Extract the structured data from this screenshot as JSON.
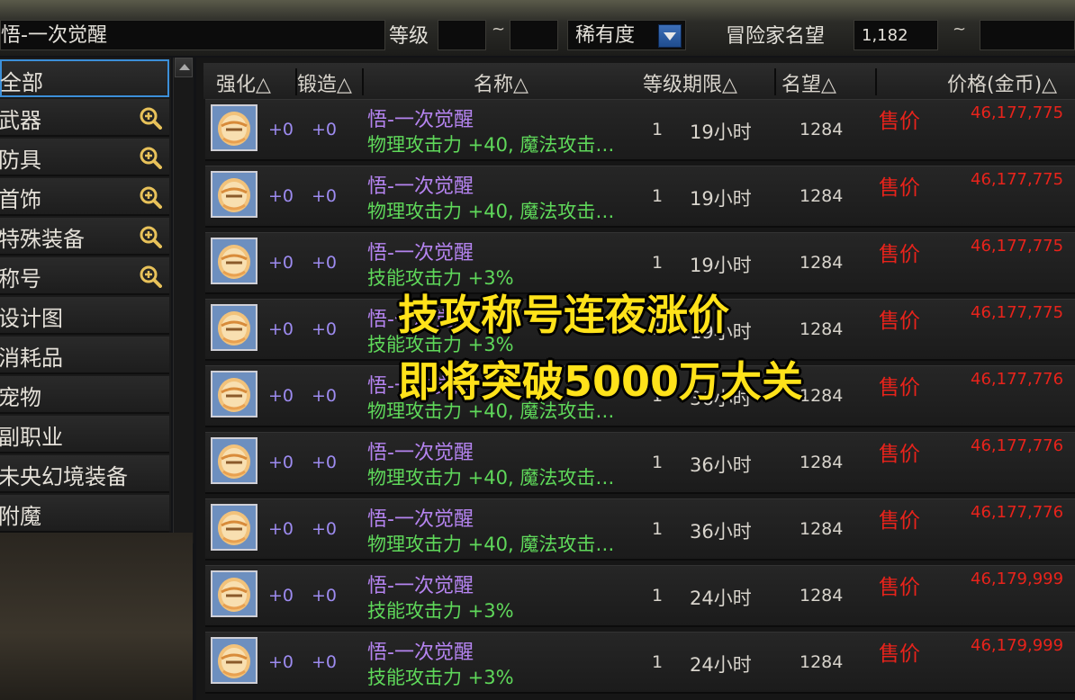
{
  "search": {
    "keyword": "悟-一次觉醒",
    "level_label": "等级",
    "level_min": "",
    "tilde": "~",
    "level_max": "",
    "rarity_label": "稀有度",
    "fame_label": "冒险家名望",
    "fame_min": "1,182",
    "fame_max": ""
  },
  "sidebar": {
    "items": [
      {
        "label": "全部",
        "icon": "none"
      },
      {
        "label": "武器",
        "icon": "zoom-in-icon"
      },
      {
        "label": "防具",
        "icon": "zoom-in-icon"
      },
      {
        "label": "首饰",
        "icon": "zoom-in-icon"
      },
      {
        "label": "特殊装备",
        "icon": "zoom-in-icon"
      },
      {
        "label": "称号",
        "icon": "zoom-in-icon"
      },
      {
        "label": "设计图",
        "icon": "none"
      },
      {
        "label": "消耗品",
        "icon": "none"
      },
      {
        "label": "宠物",
        "icon": "none"
      },
      {
        "label": "副职业",
        "icon": "none"
      },
      {
        "label": "未央幻境装备",
        "icon": "none"
      },
      {
        "label": "附魔",
        "icon": "none"
      }
    ]
  },
  "table": {
    "headers": {
      "enhance": "强化△",
      "forge": "锻造△",
      "name": "名称△",
      "level_expiry": "等级期限△",
      "fame": "名望△",
      "price": "价格(金币)△"
    },
    "rows": [
      {
        "enhance": "+0",
        "forge": "+0",
        "name": "悟-一次觉醒",
        "desc": "物理攻击力 +40, 魔法攻击…",
        "level": "1",
        "expiry": "19小时",
        "fame": "1284",
        "sale": "售价",
        "price": "46,177,775"
      },
      {
        "enhance": "+0",
        "forge": "+0",
        "name": "悟-一次觉醒",
        "desc": "物理攻击力 +40, 魔法攻击…",
        "level": "1",
        "expiry": "19小时",
        "fame": "1284",
        "sale": "售价",
        "price": "46,177,775"
      },
      {
        "enhance": "+0",
        "forge": "+0",
        "name": "悟-一次觉醒",
        "desc": "技能攻击力 +3%",
        "level": "1",
        "expiry": "19小时",
        "fame": "1284",
        "sale": "售价",
        "price": "46,177,775"
      },
      {
        "enhance": "+0",
        "forge": "+0",
        "name": "悟-一次觉醒",
        "desc": "技能攻击力 +3%",
        "level": "1",
        "expiry": "19小时",
        "fame": "1284",
        "sale": "售价",
        "price": "46,177,775"
      },
      {
        "enhance": "+0",
        "forge": "+0",
        "name": "悟-一次觉醒",
        "desc": "物理攻击力 +40, 魔法攻击…",
        "level": "1",
        "expiry": "36小时",
        "fame": "1284",
        "sale": "售价",
        "price": "46,177,776"
      },
      {
        "enhance": "+0",
        "forge": "+0",
        "name": "悟-一次觉醒",
        "desc": "物理攻击力 +40, 魔法攻击…",
        "level": "1",
        "expiry": "36小时",
        "fame": "1284",
        "sale": "售价",
        "price": "46,177,776"
      },
      {
        "enhance": "+0",
        "forge": "+0",
        "name": "悟-一次觉醒",
        "desc": "物理攻击力 +40, 魔法攻击…",
        "level": "1",
        "expiry": "36小时",
        "fame": "1284",
        "sale": "售价",
        "price": "46,177,776"
      },
      {
        "enhance": "+0",
        "forge": "+0",
        "name": "悟-一次觉醒",
        "desc": "技能攻击力 +3%",
        "level": "1",
        "expiry": "24小时",
        "fame": "1284",
        "sale": "售价",
        "price": "46,179,999"
      },
      {
        "enhance": "+0",
        "forge": "+0",
        "name": "悟-一次觉醒",
        "desc": "技能攻击力 +3%",
        "level": "1",
        "expiry": "24小时",
        "fame": "1284",
        "sale": "售价",
        "price": "46,179,999"
      }
    ]
  },
  "overlay": {
    "line1": "技攻称号连夜涨价",
    "line2": "即将突破5000万大关"
  },
  "colors": {
    "item_name": "#b584f0",
    "item_desc": "#5fd85a",
    "price": "#e8231b",
    "overlay": "#ffe21a",
    "selected_border": "#3c8fd8"
  }
}
